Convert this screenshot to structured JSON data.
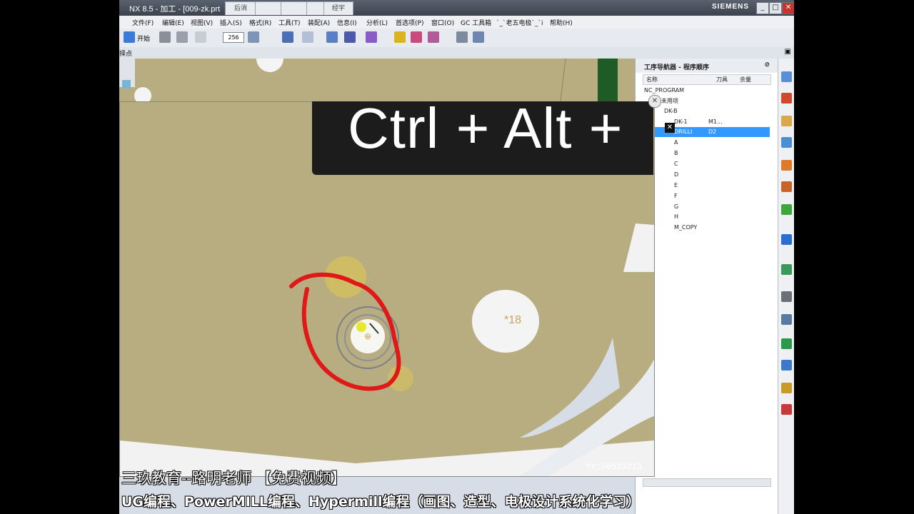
{
  "window": {
    "title": "NX 8.5 - 加工 - [009-zk.prt （",
    "brand": "SIEMENS",
    "tabs": [
      "后消",
      "",
      "",
      "",
      "经宇"
    ]
  },
  "menu": [
    "文件(F)",
    "编辑(E)",
    "视图(V)",
    "插入(S)",
    "格式(R)",
    "工具(T)",
    "装配(A)",
    "信息(I)",
    "分析(L)",
    "首选项(P)",
    "窗口(O)",
    "GC 工具箱",
    "`_`老五电极`_`i",
    "帮助(H)"
  ],
  "toolbar": {
    "start": "开始",
    "zoom": "256"
  },
  "selection_label": "择点",
  "overlay": {
    "key_combo": "Ctrl + Alt +"
  },
  "viewport": {
    "hole_label": "*18"
  },
  "navigator": {
    "title": "工序导航器 - 程序顺序",
    "columns": [
      "名称",
      "刀具",
      "余量"
    ],
    "rows": [
      {
        "name": "NC_PROGRAM",
        "tool": ""
      },
      {
        "name": "未用项",
        "tool": ""
      },
      {
        "name": "DK-B",
        "tool": ""
      },
      {
        "name": "DK-1",
        "tool": "M1..."
      },
      {
        "name": "DRILLI",
        "tool": "D2"
      },
      {
        "name": "A",
        "tool": ""
      },
      {
        "name": "B",
        "tool": ""
      },
      {
        "name": "C",
        "tool": ""
      },
      {
        "name": "D",
        "tool": ""
      },
      {
        "name": "E",
        "tool": ""
      },
      {
        "name": "F",
        "tool": ""
      },
      {
        "name": "G",
        "tool": ""
      },
      {
        "name": "H",
        "tool": ""
      },
      {
        "name": "M_COPY",
        "tool": ""
      }
    ]
  },
  "watermark": {
    "id": "YY:96523213"
  },
  "captions": {
    "line1": "三玖教育--路明老师  【免费视频】",
    "line2": "UG编程、PowerMILL编程、Hypermill编程（画图、造型、电极设计系统化学习）"
  },
  "colors": {
    "part": "#b7ad80",
    "selection": "#3399ff",
    "annotation": "#e01818"
  }
}
